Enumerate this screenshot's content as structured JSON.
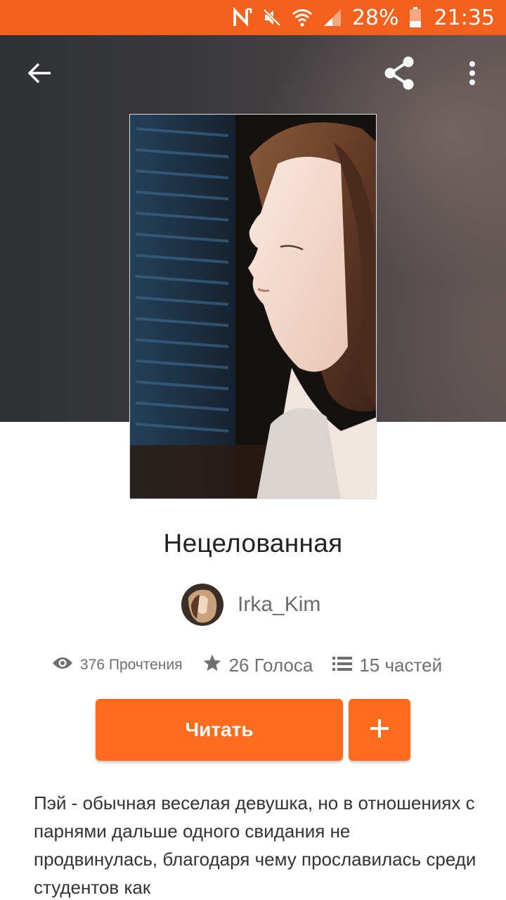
{
  "status_bar": {
    "battery": "28%",
    "time": "21:35",
    "icons": [
      "nfc-icon",
      "mute-icon",
      "wifi-icon",
      "signal-icon",
      "battery-icon"
    ]
  },
  "toolbar": {
    "icons": [
      "back-arrow-icon",
      "share-icon",
      "more-vertical-icon"
    ]
  },
  "story": {
    "title": "Нецелованная",
    "author": "Irka_Kim",
    "stats": {
      "reads": "376 Прочтения",
      "votes": "26 Голоса",
      "parts": "15 частей"
    },
    "read_label": "Читать",
    "add_label": "+",
    "description": "Пэй - обычная веселая девушка, но в отношениях с парнями дальше одного свидания не продвинулась, благодаря чему прославилась среди студентов как"
  },
  "colors": {
    "accent": "#ff6c1e",
    "status_bar": "#f4611d",
    "banner_dark": "#2f3134"
  }
}
